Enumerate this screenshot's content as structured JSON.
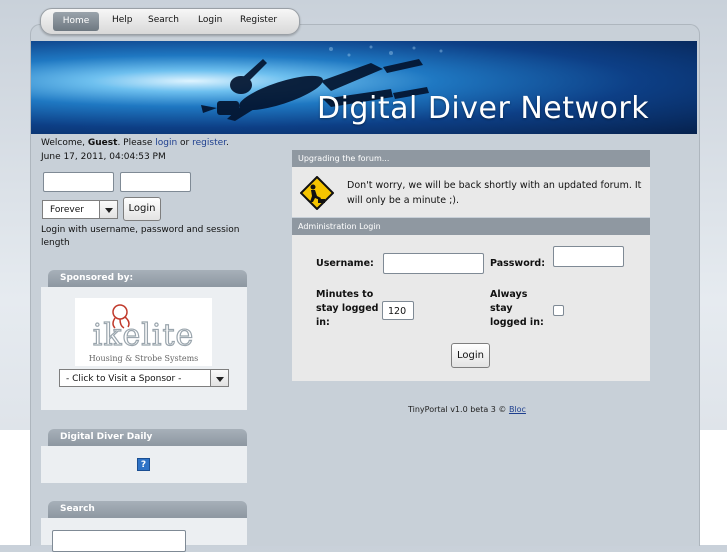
{
  "nav": {
    "items": [
      "Home",
      "Help",
      "Search",
      "Login",
      "Register"
    ]
  },
  "banner": {
    "title": "Digital Diver Network"
  },
  "sidebar": {
    "welcome_prefix": "Welcome, ",
    "guest": "Guest",
    "welcome_mid": ". Please ",
    "login_link": "login",
    "or": " or ",
    "register_link": "register",
    "end": ".",
    "datetime": "June 17, 2011, 04:04:53 PM",
    "duration_selected": "Forever",
    "login_button": "Login",
    "login_hint": "Login with username, password and session length",
    "sponsored_title": "Sponsored by:",
    "sponsor_logo_name": "ikelite",
    "sponsor_logo_tagline": "Housing & Strobe Systems",
    "sponsor_select": "- Click to Visit a Sponsor -",
    "daily_title": "Digital Diver Daily",
    "daily_icon": "?",
    "search_title": "Search"
  },
  "upgrade": {
    "header": "Upgrading the forum...",
    "message": "Don't worry, we will be back shortly with an updated forum. It will only be a minute ;)."
  },
  "admin": {
    "header": "Administration Login",
    "username_label": "Username:",
    "password_label": "Password:",
    "minutes_label_1": "Minutes to",
    "minutes_label_2": "stay logged",
    "minutes_label_3": "in:",
    "minutes_value": "120",
    "always_label_1": "Always",
    "always_label_2": "stay",
    "always_label_3": "logged in:",
    "login_button": "Login"
  },
  "footer": {
    "text": "TinyPortal v1.0 beta 3 © ",
    "link": "Bloc"
  },
  "colors": {
    "frame": "#c8d0d8",
    "panel_header": "#8f98a1",
    "link": "#1e3f8f"
  }
}
